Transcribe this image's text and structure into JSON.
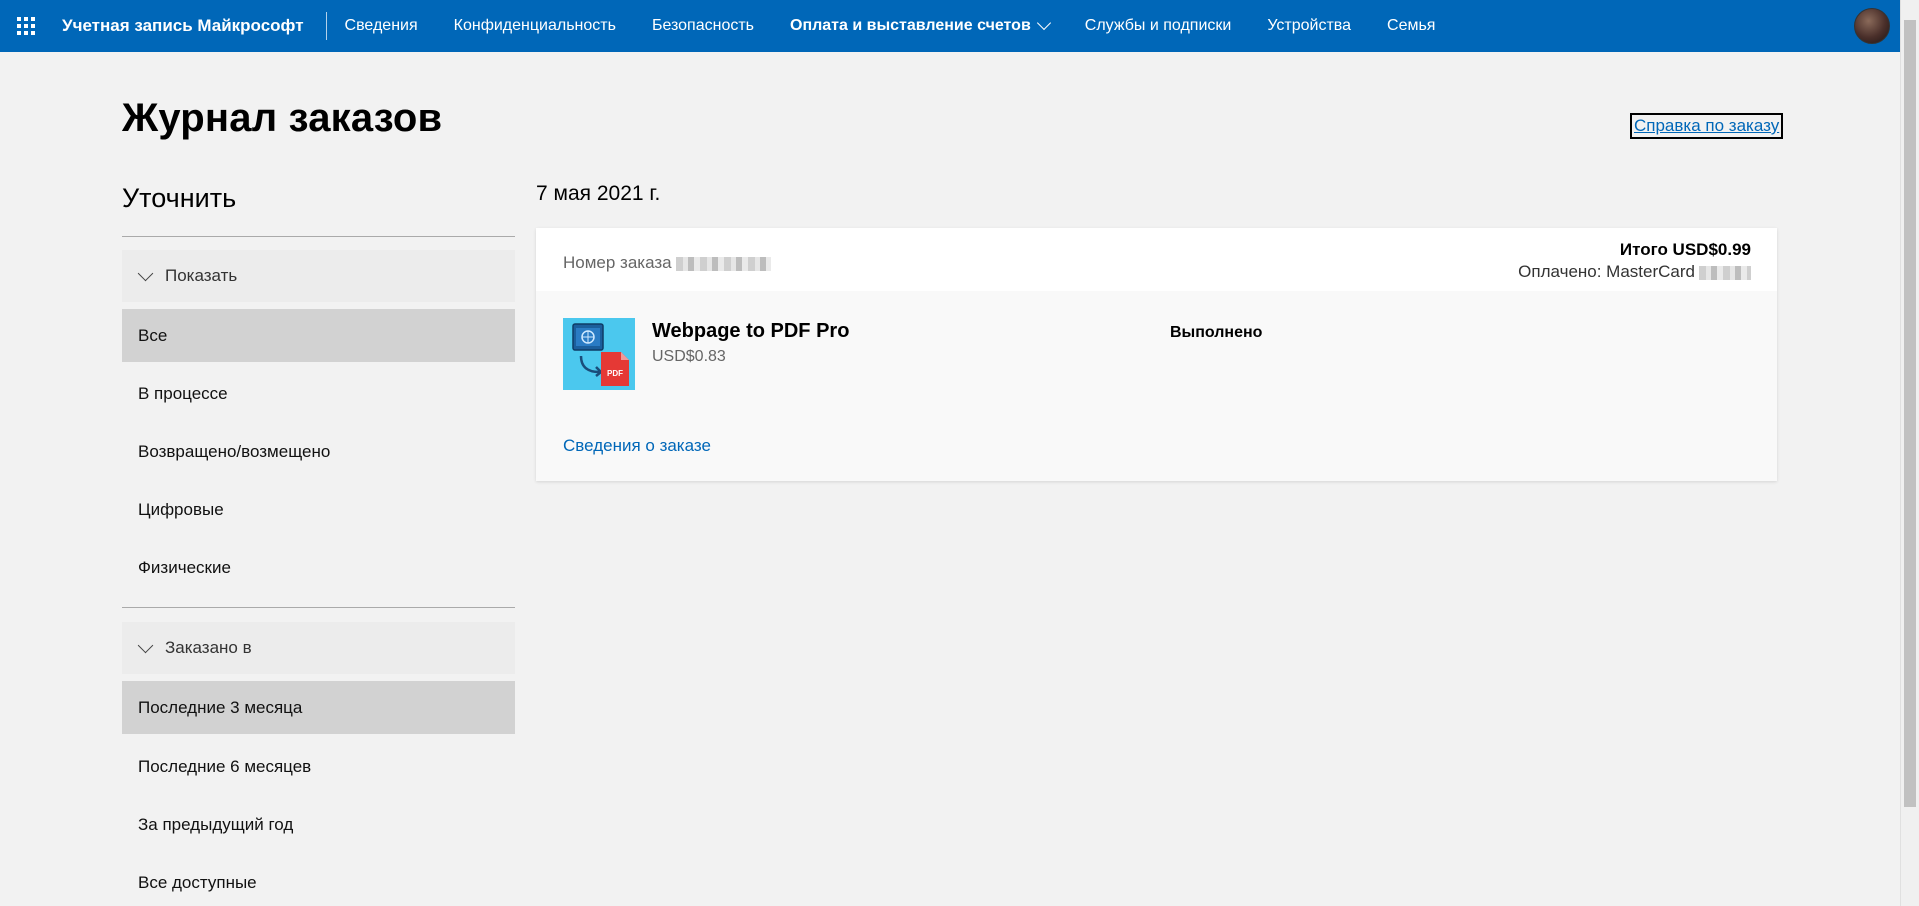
{
  "header": {
    "brand": "Учетная запись Майкрософт",
    "nav": [
      {
        "label": "Сведения"
      },
      {
        "label": "Конфиденциальность"
      },
      {
        "label": "Безопасность"
      },
      {
        "label": "Оплата и выставление счетов"
      },
      {
        "label": "Службы и подписки"
      },
      {
        "label": "Устройства"
      },
      {
        "label": "Семья"
      }
    ],
    "active_nav": "Оплата и выставление счетов"
  },
  "page": {
    "title": "Журнал заказов",
    "help_link": "Справка по заказу"
  },
  "refine": {
    "title": "Уточнить",
    "show": {
      "label": "Показать",
      "items": [
        {
          "label": "Все",
          "selected": true
        },
        {
          "label": "В процессе"
        },
        {
          "label": "Возвращено/возмещено"
        },
        {
          "label": "Цифровые"
        },
        {
          "label": "Физические"
        }
      ]
    },
    "ordered": {
      "label": "Заказано в",
      "items": [
        {
          "label": "Последние 3 месяца",
          "selected": true
        },
        {
          "label": "Последние 6 месяцев"
        },
        {
          "label": "За предыдущий год"
        },
        {
          "label": "Все доступные"
        }
      ]
    }
  },
  "order": {
    "date": "7 мая 2021 г.",
    "number_label": "Номер заказа",
    "total": "Итого USD$0.99",
    "paid": "Оплачено: MasterCard",
    "product": {
      "name": "Webpage to PDF Pro",
      "price": "USD$0.83",
      "icon": "webpage-to-pdf-app-icon",
      "icon_badge": "PDF"
    },
    "status": "Выполнено",
    "details_link": "Сведения о заказе"
  },
  "colors": {
    "brand_blue": "#0067b8",
    "page_bg": "#f2f2f2",
    "selected_bg": "#d2d2d2"
  }
}
